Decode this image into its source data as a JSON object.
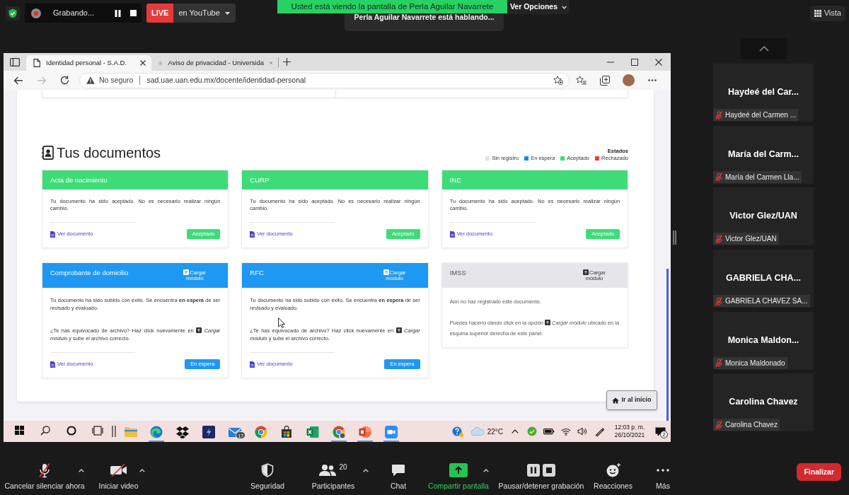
{
  "meeting": {
    "recording_label": "Grabando...",
    "live_badge": "LIVE",
    "stream_target": "en YouTube",
    "share_banner": "Usted está viendo la pantalla de Perla Aguilar Navarrete",
    "view_options": "Ver Opciones",
    "speaker_notice": "Perla Aguilar Navarrete está hablando...",
    "view_button": "Vista"
  },
  "browser": {
    "tabs": [
      {
        "kind": "page",
        "title": "Identidad personal - S.A.D.",
        "selected": true
      },
      {
        "kind": "site",
        "title": "Aviso de privacidad - Universida",
        "selected": false
      }
    ],
    "forward_disabled": true,
    "security": "No seguro",
    "address": "sad.uae.uan.edu.mx/docente/identidad-personal"
  },
  "page": {
    "heading": "Tus documentos",
    "legend_title": "Estados",
    "legend": [
      {
        "label": "Sin registro",
        "color": "#e3e3e3"
      },
      {
        "label": "En espera",
        "color": "#1e88e5"
      },
      {
        "label": "Aceptado",
        "color": "#3ddc78"
      },
      {
        "label": "Rechazado",
        "color": "#e0452e"
      }
    ],
    "documents": [
      {
        "kind": "accepted",
        "title": "Acta de nacimiento",
        "paragraphs": [
          [
            "Tu documento ha sido aceptado. No es necesario realizar ningún cambio."
          ]
        ],
        "link": "Ver documento",
        "badge": "Aceptado"
      },
      {
        "kind": "accepted",
        "title": "CURP",
        "paragraphs": [
          [
            "Tu documento ha sido aceptado. No es necesario realizar ningún cambio."
          ]
        ],
        "link": "Ver documento",
        "badge": "Aceptado"
      },
      {
        "kind": "accepted",
        "title": "INE",
        "paragraphs": [
          [
            "Tu documento ha sido aceptado. No es necesario realizar ningún cambio."
          ]
        ],
        "link": "Ver documento",
        "badge": "Aceptado"
      },
      {
        "kind": "pending",
        "title": "Comprobante de domicilio",
        "upload": "Cargar módulo",
        "paragraphs": [
          [
            "Tu documento ha sido subido con éxito. Se encuentra **en espera** de ser revisado y evaluado."
          ],
          [
            "¿Te has equivocado de archivo? Haz click nuevamente en",
            "*Cargar módulo* y sube el archivo correcto."
          ]
        ],
        "link": "Ver documento",
        "badge": "En espera"
      },
      {
        "kind": "pending",
        "title": "RFC",
        "upload": "Cargar módulo",
        "paragraphs": [
          [
            "Tu documento ha sido subido con éxito. Se encuentra **en espera** de ser revisado y evaluado."
          ],
          [
            "¿Te has equivocado de archivo? Haz click nuevamente en",
            "*Cargar módulo* y sube el archivo correcto."
          ]
        ],
        "link": "Ver documento",
        "badge": "En espera"
      },
      {
        "kind": "empty",
        "title": "IMSS",
        "upload": "Cargar módulo",
        "paragraphs": [
          [
            "Aún no haz registrado este documento."
          ],
          [
            "Puedes hacerlo dando click en la opción",
            "*Cargar módulo* ubicado en la esquina superior derecha de este panel."
          ]
        ]
      }
    ],
    "home_button": "Ir al inicio"
  },
  "taskbar": {
    "apps": [
      {
        "kind": "explorer",
        "open": false
      },
      {
        "kind": "edge",
        "open": true
      },
      {
        "kind": "dropbox",
        "open": false
      },
      {
        "kind": "app",
        "open": false
      },
      {
        "kind": "mail",
        "open": false,
        "badge": "17"
      },
      {
        "kind": "chrome",
        "open": false
      },
      {
        "kind": "store",
        "open": false
      },
      {
        "kind": "excel",
        "open": false
      },
      {
        "kind": "chrome-profile",
        "open": true
      },
      {
        "kind": "powerpoint",
        "open": true
      },
      {
        "kind": "zoom",
        "open": true
      }
    ],
    "temperature": "22°C",
    "time": "12:03 p. m.",
    "date": "26/10/2021",
    "notifications": "2"
  },
  "toolbar": {
    "items": [
      {
        "kind": "mic",
        "label": "Cancelar silenciar ahora",
        "off": true,
        "caret": true
      },
      {
        "kind": "video",
        "label": "Iniciar video",
        "off": true,
        "caret": true
      },
      {
        "kind": "security",
        "label": "Seguridad",
        "caret": false
      },
      {
        "kind": "participants",
        "label": "Participantes",
        "count": "20",
        "caret": true
      },
      {
        "kind": "chat",
        "label": "Chat",
        "caret": false
      },
      {
        "kind": "share",
        "label": "Compartir pantalla",
        "caret": true
      },
      {
        "kind": "recording",
        "label": "Pausar/detener grabación",
        "caret": false
      },
      {
        "kind": "reactions",
        "label": "Reacciones",
        "caret": false
      },
      {
        "kind": "more",
        "label": "Más",
        "caret": false
      }
    ],
    "end_button": "Finalizar"
  },
  "participants": [
    {
      "name": "Haydeé del Car...",
      "label": "Haydeé del Carmen ...",
      "muted": true
    },
    {
      "name": "María del Carm...",
      "label": "María del Carmen Lla...",
      "muted": true
    },
    {
      "name": "Victor Glez/UAN",
      "label": "Victor Glez/UAN",
      "muted": true
    },
    {
      "name": "GABRIELA CHA...",
      "label": "GABRIELA CHAVEZ SA...",
      "muted": true
    },
    {
      "name": "Monica Maldon...",
      "label": "Monica Maldonado",
      "muted": true
    },
    {
      "name": "Carolina Chavez",
      "label": "Carolina Chavez",
      "muted": true
    }
  ]
}
